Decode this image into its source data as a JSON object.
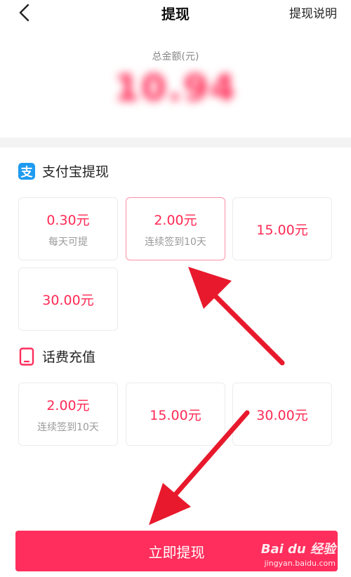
{
  "header": {
    "title": "提现",
    "help_label": "提现说明"
  },
  "balance": {
    "label": "总金额(元)",
    "amount": "10.94"
  },
  "alipay": {
    "icon_char": "支",
    "title": "支付宝提现",
    "options": [
      {
        "amount": "0.30元",
        "sub": "每天可提"
      },
      {
        "amount": "2.00元",
        "sub": "连续签到10天"
      },
      {
        "amount": "15.00元",
        "sub": ""
      },
      {
        "amount": "30.00元",
        "sub": ""
      }
    ]
  },
  "phone": {
    "title": "话费充值",
    "options": [
      {
        "amount": "2.00元",
        "sub": "连续签到10天"
      },
      {
        "amount": "15.00元",
        "sub": ""
      },
      {
        "amount": "30.00元",
        "sub": ""
      }
    ]
  },
  "submit_label": "立即提现",
  "watermark": {
    "logo": "Bai du 经验",
    "url": "jingyan.baidu.com"
  },
  "colors": {
    "accent": "#ff2e5c",
    "alipay_blue": "#1e9bf0",
    "annotation_arrow": "#e8192c"
  }
}
